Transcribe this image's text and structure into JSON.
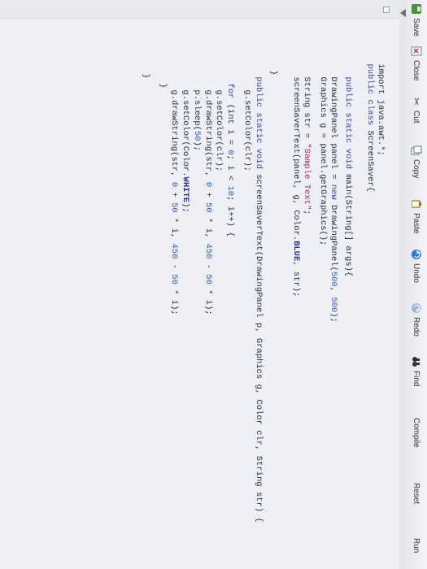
{
  "toolbar": {
    "save": "Save",
    "close": "Close",
    "cut": "Cut",
    "copy": "Copy",
    "paste": "Paste",
    "undo": "Undo",
    "redo": "Redo",
    "find": "Find",
    "compile": "Compile",
    "reset": "Reset",
    "run": "Run"
  },
  "editor": {
    "lines": {
      "l1": {
        "a": "import java.awt.*;"
      },
      "l2": {
        "kw1": "public",
        "kw2": "class",
        "rest": " ScreenSaver{"
      },
      "l3": {
        "kw1": "public",
        "kw2": "static",
        "kw3": "void",
        "rest": " main(String[] args){"
      },
      "l4": {
        "a": "DrawingPanel panel = ",
        "kw": "new",
        "b": " DrawingPanel(",
        "n1": "500",
        "c": ", ",
        "n2": "500",
        "d": ");"
      },
      "l5": {
        "a": "Graphics g = panel.getGraphics();"
      },
      "l6": {
        "a": "String str = ",
        "s": "\"Sample Text\"",
        "b": ";"
      },
      "l7": {
        "a": "screenSaverText(panel, g, Color.",
        "c": "BLUE",
        "b": ", str);"
      },
      "l8": {
        "a": "}"
      },
      "l9": {
        "kw1": "public",
        "kw2": "static",
        "kw3": "void",
        "rest": " screenSaverText(DrawingPanel p, Graphics g, Color clr, String str) {"
      },
      "l10": {
        "a": "g.setColor(clr);"
      },
      "l11": {
        "kw": "for",
        "a": " (int i = ",
        "n1": "0",
        "b": "; i < ",
        "n2": "10",
        "c": "; i++) {"
      },
      "l12": {
        "a": "g.setColor(clr);"
      },
      "l13": {
        "a": "g.drawString(str, ",
        "n1": "0",
        "b": " + ",
        "n2": "50",
        "c": " * i, ",
        "n3": "450",
        "d": " - ",
        "n4": "50",
        "e": " * i);"
      },
      "l14": {
        "a": "p.sleep(",
        "n1": "50",
        "b": ");"
      },
      "l15": {
        "a": "g.setColor(Color.",
        "c": "WHITE",
        "b": ");"
      },
      "l16": {
        "a": "g.drawString(str, ",
        "n1": "0",
        "b": " + ",
        "n2": "50",
        "c": " * i, ",
        "n3": "450",
        "d": " - ",
        "n4": "50",
        "e": " * i);"
      },
      "l17": {
        "a": "}"
      },
      "l18": {
        "a": "}"
      }
    }
  }
}
